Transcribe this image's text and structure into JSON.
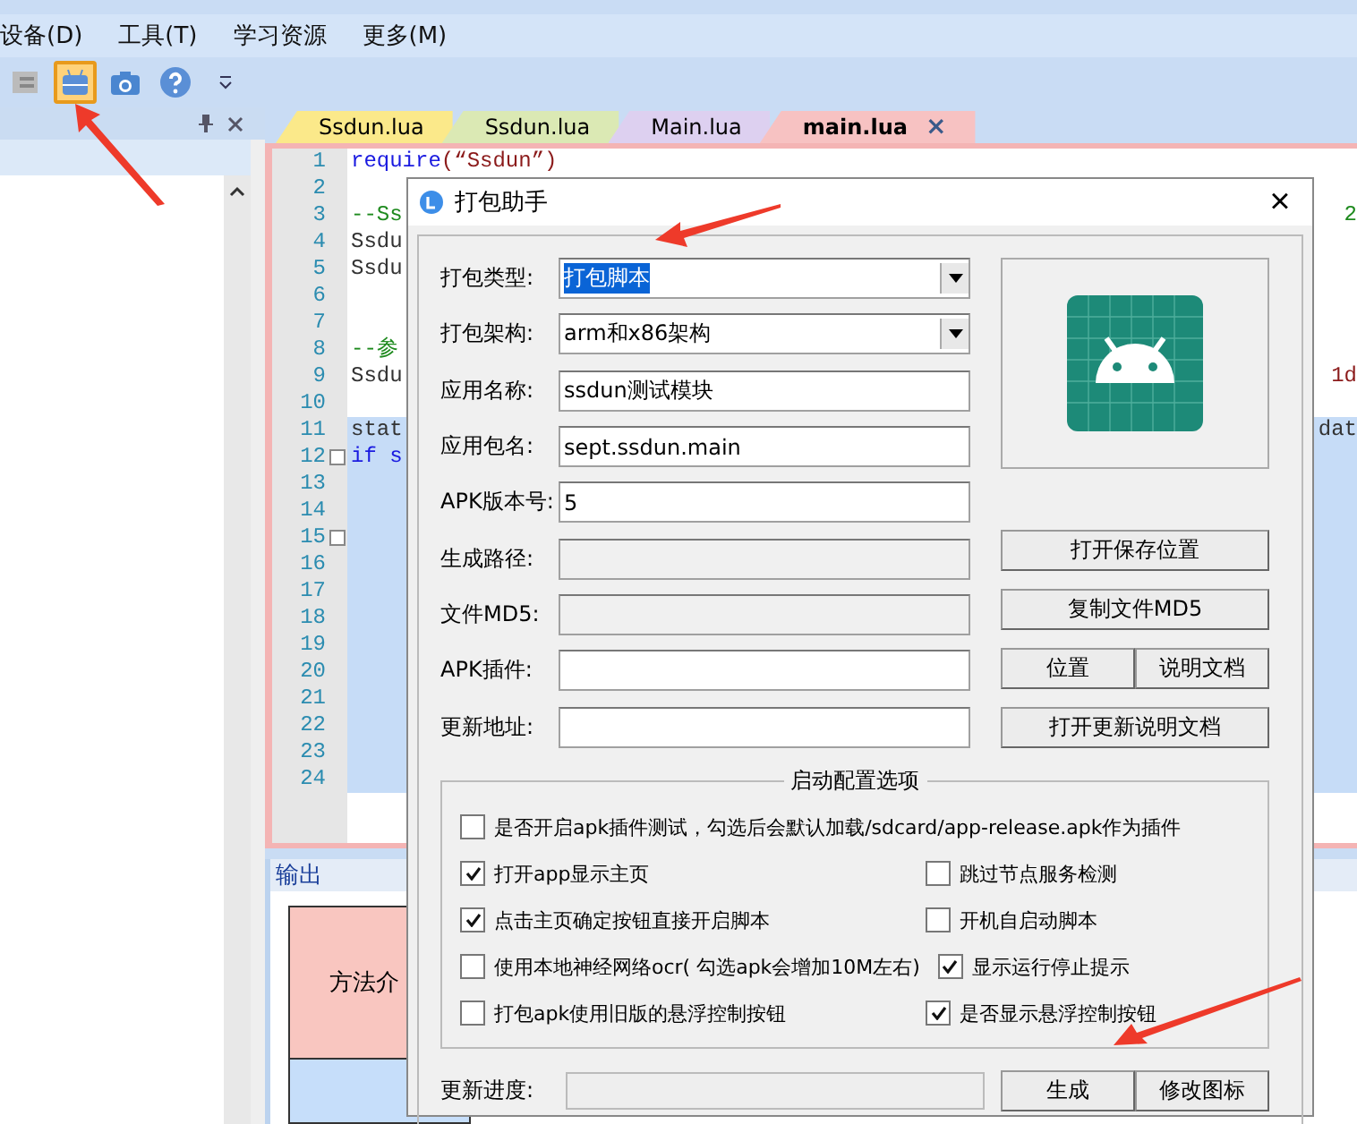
{
  "menu": [
    "设备(D)",
    "工具(T)",
    "学习资源",
    "更多(M)"
  ],
  "toolbar": [
    {
      "kind": "list",
      "selected": false
    },
    {
      "kind": "robot",
      "selected": true
    },
    {
      "kind": "camera",
      "selected": false
    },
    {
      "kind": "help",
      "selected": false
    },
    {
      "kind": "overflow",
      "selected": false
    }
  ],
  "tabs": [
    {
      "label": "Ssdun.lua",
      "color": "#fbe98a",
      "selected": false
    },
    {
      "label": "Ssdun.lua",
      "color": "#dbe9b4",
      "selected": false
    },
    {
      "label": "Main.lua",
      "color": "#ddd0f0",
      "selected": false
    },
    {
      "label": "main.lua",
      "color": "#f7c2c2",
      "selected": true,
      "close": "×"
    }
  ],
  "editor": {
    "lines": [
      {
        "number": "1",
        "segments": [
          {
            "text": "require",
            "kind": "keyword"
          },
          {
            "text": "(“Ssdun”)",
            "kind": "string"
          }
        ],
        "selected": false,
        "fold": false
      },
      {
        "number": "2",
        "selected": false,
        "fold": false
      },
      {
        "number": "3",
        "segments": [
          {
            "text": "--Ss",
            "kind": "comment"
          }
        ],
        "tail": {
          "text": "2",
          "kind": "comment"
        },
        "selected": false,
        "fold": false
      },
      {
        "number": "4",
        "segments": [
          {
            "text": "Ssdu",
            "kind": "code"
          }
        ],
        "selected": false,
        "fold": false
      },
      {
        "number": "5",
        "segments": [
          {
            "text": "Ssdu",
            "kind": "code"
          }
        ],
        "selected": false,
        "fold": false
      },
      {
        "number": "6",
        "selected": false,
        "fold": false
      },
      {
        "number": "7",
        "selected": false,
        "fold": false
      },
      {
        "number": "8",
        "segments": [
          {
            "text": "--参",
            "kind": "comment"
          }
        ],
        "selected": false,
        "fold": false
      },
      {
        "number": "9",
        "segments": [
          {
            "text": "Ssdu",
            "kind": "code"
          }
        ],
        "tail": {
          "text": "1d",
          "kind": "string"
        },
        "selected": false,
        "fold": false
      },
      {
        "number": "10",
        "selected": false,
        "fold": false
      },
      {
        "number": "11",
        "segments": [
          {
            "text": "stat",
            "kind": "code"
          }
        ],
        "tail": {
          "text": "dat",
          "kind": "code"
        },
        "selected": true,
        "fold": false
      },
      {
        "number": "12",
        "segments": [
          {
            "text": "if s",
            "kind": "keyword"
          }
        ],
        "selected": true,
        "fold": true
      },
      {
        "number": "13",
        "selected": true,
        "fold": false
      },
      {
        "number": "14",
        "selected": true,
        "fold": false
      },
      {
        "number": "15",
        "selected": true,
        "fold": true
      },
      {
        "number": "16",
        "selected": true,
        "fold": false
      },
      {
        "number": "17",
        "selected": true,
        "fold": false
      },
      {
        "number": "18",
        "selected": true,
        "fold": false
      },
      {
        "number": "19",
        "selected": true,
        "fold": false
      },
      {
        "number": "20",
        "selected": true,
        "fold": false
      },
      {
        "number": "21",
        "selected": true,
        "fold": false
      },
      {
        "number": "22",
        "selected": true,
        "fold": false
      },
      {
        "number": "23",
        "selected": true,
        "fold": false
      },
      {
        "number": "24",
        "selected": true,
        "fold": false
      }
    ]
  },
  "output": {
    "title": "输出",
    "cell": "方法介"
  },
  "dialog": {
    "title": "打包助手",
    "close": "×",
    "fields": [
      {
        "label": "打包类型:",
        "kind": "dropdown",
        "value": "打包脚本",
        "selected": true
      },
      {
        "label": "打包架构:",
        "kind": "dropdown",
        "value": "arm和x86架构",
        "selected": false
      },
      {
        "label": "应用名称:",
        "kind": "text",
        "value": "ssdun测试模块"
      },
      {
        "label": "应用包名:",
        "kind": "text",
        "value": "sept.ssdun.main"
      },
      {
        "label": "APK版本号:",
        "kind": "text",
        "value": "5"
      },
      {
        "label": "生成路径:",
        "kind": "readonly"
      },
      {
        "label": "文件MD5:",
        "kind": "readonly"
      },
      {
        "label": "APK插件:",
        "kind": "text"
      },
      {
        "label": "更新地址:",
        "kind": "text"
      }
    ],
    "side_buttons": [
      [
        "打开保存位置"
      ],
      [
        "复制文件MD5"
      ],
      [
        "位置",
        "说明文档"
      ],
      [
        "打开更新说明文档"
      ]
    ],
    "options_title": "启动配置选项",
    "options": [
      [
        {
          "label": "是否开启apk插件测试，勾选后会默认加载/sdcard/app-release.apk作为插件",
          "checked": false
        }
      ],
      [
        {
          "label": "打开app显示主页",
          "checked": true
        },
        {
          "label": "跳过节点服务检测",
          "checked": false
        }
      ],
      [
        {
          "label": "点击主页确定按钮直接开启脚本",
          "checked": true
        },
        {
          "label": "开机自启动脚本",
          "checked": false
        }
      ],
      [
        {
          "label": "使用本地神经网络ocr( 勾选apk会增加10M左右)",
          "checked": false
        },
        {
          "label": "显示运行停止提示",
          "checked": true
        }
      ],
      [
        {
          "label": "打包apk使用旧版的悬浮控制按钮",
          "checked": false
        },
        {
          "label": "是否显示悬浮控制按钮",
          "checked": true
        }
      ]
    ],
    "progress": {
      "label": "更新进度:",
      "level": 0
    },
    "buttons": [
      "生成",
      "修改图标"
    ]
  }
}
